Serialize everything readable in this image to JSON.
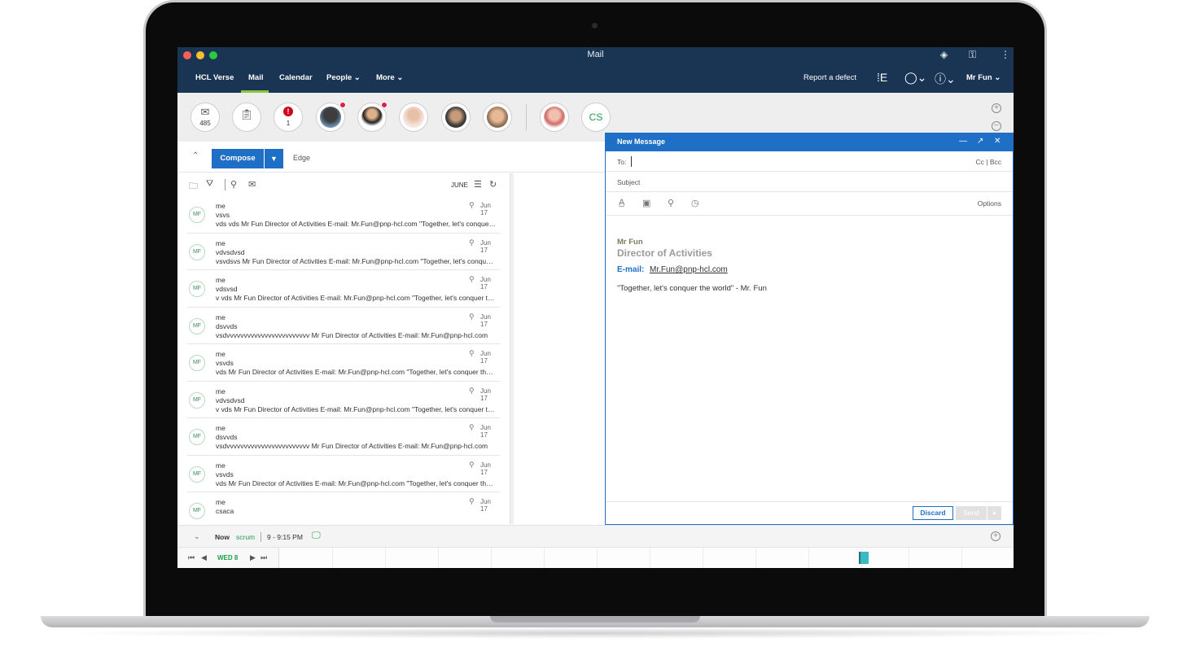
{
  "window": {
    "title": "Mail"
  },
  "nav": {
    "brand": "HCL Verse",
    "tabs": [
      {
        "label": "Mail",
        "active": true
      },
      {
        "label": "Calendar"
      },
      {
        "label": "People"
      },
      {
        "label": "More"
      }
    ],
    "report_defect": "Report a defect",
    "user_name": "Mr Fun"
  },
  "bubbles": {
    "inbox_count": "485",
    "alert_count": "1",
    "alert_symbol": "!",
    "contact_initials": "CS"
  },
  "compose": {
    "button_label": "Compose",
    "folder_label": "Edge"
  },
  "list": {
    "month_label": "JUNE",
    "rows": [
      {
        "initials": "MF",
        "sender": "me",
        "subject": "vsvs",
        "preview": "vds vds Mr Fun Director of Activities E-mail: Mr.Fun@pnp-hcl.com \"Together, let's conquer the world\"",
        "date": "Jun 17"
      },
      {
        "initials": "MF",
        "sender": "me",
        "subject": "vdvsdvsd",
        "preview": "vsvdsvs Mr Fun Director of Activities E-mail: Mr.Fun@pnp-hcl.com \"Together, let's conquer the world\"",
        "date": "Jun 17"
      },
      {
        "initials": "MF",
        "sender": "me",
        "subject": "vdsvsd",
        "preview": "v vds Mr Fun Director of Activities E-mail: Mr.Fun@pnp-hcl.com \"Together, let's conquer the world\"",
        "date": "Jun 17"
      },
      {
        "initials": "MF",
        "sender": "me",
        "subject": "dsvvds",
        "preview": "vsdvvvvvvvvvvvvvvvvvvvvvvvv Mr Fun Director of Activities E-mail: Mr.Fun@pnp-hcl.com",
        "date": "Jun 17"
      },
      {
        "initials": "MF",
        "sender": "me",
        "subject": "vsvds",
        "preview": "vds Mr Fun Director of Activities E-mail: Mr.Fun@pnp-hcl.com \"Together, let's conquer the world\"",
        "date": "Jun 17"
      },
      {
        "initials": "MF",
        "sender": "me",
        "subject": "vdvsdvsd",
        "preview": "v vds Mr Fun Director of Activities E-mail: Mr.Fun@pnp-hcl.com \"Together, let's conquer the world\"",
        "date": "Jun 17"
      },
      {
        "initials": "MF",
        "sender": "me",
        "subject": "dsvvds",
        "preview": "vsdvvvvvvvvvvvvvvvvvvvvvvvv Mr Fun Director of Activities E-mail: Mr.Fun@pnp-hcl.com",
        "date": "Jun 17"
      },
      {
        "initials": "MF",
        "sender": "me",
        "subject": "vsvds",
        "preview": "vds Mr Fun Director of Activities E-mail: Mr.Fun@pnp-hcl.com \"Together, let's conquer the world\"",
        "date": "Jun 17"
      },
      {
        "initials": "MF",
        "sender": "me",
        "subject": "csaca",
        "preview": "",
        "date": "Jun 17"
      }
    ]
  },
  "new_message": {
    "title": "New Message",
    "to_label": "To:",
    "cc_bcc_label": "Cc | Bcc",
    "subject_placeholder": "Subject",
    "options_label": "Options",
    "signature": {
      "name": "Mr Fun",
      "title": "Director of Activities",
      "email_label": "E-mail:",
      "email": "Mr.Fun@pnp-hcl.com",
      "quote": "\"Together, let's conquer the world\" - Mr. Fun"
    },
    "discard_label": "Discard",
    "send_label": "Send"
  },
  "calendar_strip": {
    "now_label": "Now",
    "event_name": "scrum",
    "event_time": "9 - 9:15 PM",
    "day_label": "WED 8"
  },
  "colors": {
    "navbar": "#1a3454",
    "accent_blue": "#1f6fc7",
    "active_tab_underline": "#8cc63f",
    "green_text": "#1e9e4a",
    "timeline_event": "#3bb8c4"
  }
}
